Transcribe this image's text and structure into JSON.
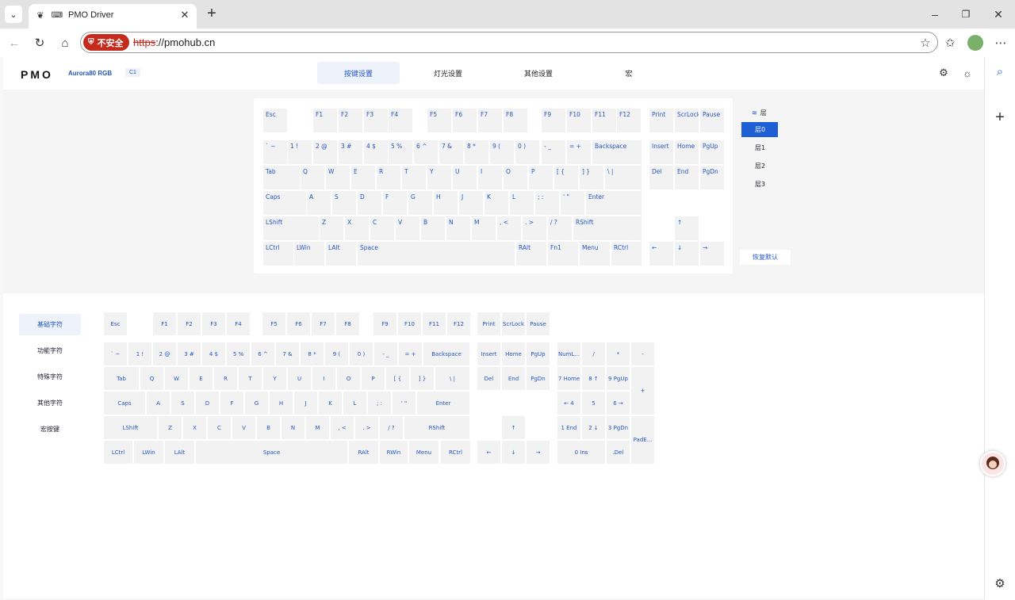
{
  "browser": {
    "tab_title": "PMO Driver",
    "warning": "不安全",
    "url_scheme": "https",
    "url_rest": "://pmohub.cn"
  },
  "app": {
    "logo": "PMO",
    "model": "Aurora80 RGB",
    "badge": "C1",
    "tabs": [
      "按键设置",
      "灯光设置",
      "其他设置",
      "宏"
    ]
  },
  "layers": {
    "title": "层",
    "items": [
      "层0",
      "层1",
      "层2",
      "层3"
    ],
    "active": 0,
    "reset": "恢复默认"
  },
  "keyboard_rows": [
    [
      "Esc",
      "F1",
      "F2",
      "F3",
      "F4",
      "F5",
      "F6",
      "F7",
      "F8",
      "F9",
      "F10",
      "F11",
      "F12",
      "Print",
      "ScrLock",
      "Pause"
    ],
    [
      "` ~",
      "1 !",
      "2 @",
      "3 #",
      "4 $",
      "5 %",
      "6 ^",
      "7 &",
      "8 *",
      "9 (",
      "0 )",
      "- _",
      "= +",
      "Backspace",
      "Insert",
      "Home",
      "PgUp"
    ],
    [
      "Tab",
      "Q",
      "W",
      "E",
      "R",
      "T",
      "Y",
      "U",
      "I",
      "O",
      "P",
      "[ {",
      "] }",
      "\\ |",
      "Del",
      "End",
      "PgDn"
    ],
    [
      "Caps",
      "A",
      "S",
      "D",
      "F",
      "G",
      "H",
      "J",
      "K",
      "L",
      "; :",
      "' \"",
      "Enter"
    ],
    [
      "LShift",
      "Z",
      "X",
      "C",
      "V",
      "B",
      "N",
      "M",
      ", <",
      ". >",
      "/ ?",
      "RShift",
      "↑"
    ],
    [
      "LCtrl",
      "LWin",
      "LAlt",
      "Space",
      "RAlt",
      "Fn1",
      "Menu",
      "RCtrl",
      "←",
      "↓",
      "→"
    ]
  ],
  "categories": {
    "items": [
      "基础字符",
      "功能字符",
      "特殊字符",
      "其他字符",
      "宏按键"
    ],
    "active": 0
  },
  "basic_rows": [
    [
      "Esc",
      "F1",
      "F2",
      "F3",
      "F4",
      "F5",
      "F6",
      "F7",
      "F8",
      "F9",
      "F10",
      "F11",
      "F12",
      "Print",
      "ScrLock",
      "Pause"
    ],
    [
      "` ~",
      "1 !",
      "2 @",
      "3 #",
      "4 $",
      "5 %",
      "6 ^",
      "7 &",
      "8 *",
      "9 (",
      "0 )",
      "- _",
      "= +",
      "Backspace",
      "Insert",
      "Home",
      "PgUp",
      "NumL...",
      "/",
      "*",
      "-"
    ],
    [
      "Tab",
      "Q",
      "W",
      "E",
      "R",
      "T",
      "Y",
      "U",
      "I",
      "O",
      "P",
      "[ {",
      "] }",
      "\\ |",
      "Del",
      "End",
      "PgDn",
      "7 Home",
      "8 ↑",
      "9 PgUp",
      "+"
    ],
    [
      "Caps",
      "A",
      "S",
      "D",
      "F",
      "G",
      "H",
      "J",
      "K",
      "L",
      "; :",
      "' \"",
      "Enter",
      "← 4",
      "5",
      "6 →"
    ],
    [
      "LShift",
      "Z",
      "X",
      "C",
      "V",
      "B",
      "N",
      "M",
      ", <",
      ". >",
      "/ ?",
      "RShift",
      "↑",
      "1 End",
      "2 ↓",
      "3 PgDn",
      "PadE..."
    ],
    [
      "LCtrl",
      "LWin",
      "LAlt",
      "Space",
      "RAlt",
      "RWin",
      "Menu",
      "RCtrl",
      "←",
      "↓",
      "→",
      "0 Ins",
      ".Del"
    ]
  ]
}
